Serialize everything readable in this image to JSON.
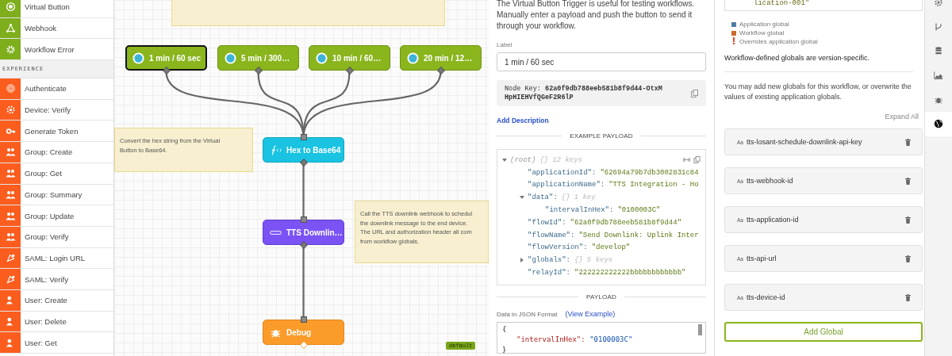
{
  "sidebar": {
    "items": [
      {
        "label": "Virtual Button",
        "kind": "trigger"
      },
      {
        "label": "Webhook",
        "kind": "trigger"
      },
      {
        "label": "Workflow Error",
        "kind": "trigger"
      },
      {
        "label": "EXPERIENCE",
        "kind": "header"
      },
      {
        "label": "Authenticate",
        "kind": "experience"
      },
      {
        "label": "Device: Verify",
        "kind": "experience"
      },
      {
        "label": "Generate Token",
        "kind": "experience"
      },
      {
        "label": "Group: Create",
        "kind": "experience"
      },
      {
        "label": "Group: Get",
        "kind": "experience"
      },
      {
        "label": "Group: Summary",
        "kind": "experience"
      },
      {
        "label": "Group: Update",
        "kind": "experience"
      },
      {
        "label": "Group: Verify",
        "kind": "experience"
      },
      {
        "label": "SAML: Login URL",
        "kind": "experience"
      },
      {
        "label": "SAML: Verify",
        "kind": "experience"
      },
      {
        "label": "User: Create",
        "kind": "experience"
      },
      {
        "label": "User: Delete",
        "kind": "experience"
      },
      {
        "label": "User: Get",
        "kind": "experience"
      }
    ]
  },
  "canvas": {
    "notes": [
      {
        "lines": [
          "Convert the hex string from the Virtual",
          "Button to Base64."
        ]
      },
      {
        "lines": [
          "Call the TTS downlink webhook to schedul",
          "the downlink message to the end device.",
          "The URL and authorization header all com",
          "from workflow globals."
        ]
      }
    ],
    "nodes": [
      {
        "label": "1 min / 60 sec",
        "kind": "trigger",
        "selected": true
      },
      {
        "label": "5 min / 300…",
        "kind": "trigger",
        "selected": false
      },
      {
        "label": "10 min / 60…",
        "kind": "trigger",
        "selected": false
      },
      {
        "label": "20 min / 12…",
        "kind": "trigger",
        "selected": false
      },
      {
        "label": "Hex to Base64",
        "kind": "function",
        "selected": false
      },
      {
        "label": "TTS Downlin…",
        "kind": "http",
        "selected": false
      },
      {
        "label": "Debug",
        "kind": "debug",
        "selected": false
      }
    ],
    "version_badge": "default"
  },
  "node_editor": {
    "description": "The Virtual Button Trigger is useful for testing workflows. Manually enter a payload and push the button to send it through your workflow.",
    "label_field": {
      "label": "Label",
      "value": "1 min / 60 sec"
    },
    "node_key": {
      "label": "Node Key:",
      "value": "62a0f9db788eeb581b8f9d44-OtxMHpHIEHVfQGeF2R6lP"
    },
    "add_description": "Add Description",
    "example_payload": {
      "title": "EXAMPLE PAYLOAD",
      "root": {
        "kind": "root",
        "key": "(root)",
        "braces": "{}",
        "summary": "12 keys",
        "expanded": true,
        "children": [
          {
            "key": "\"applicationId\":",
            "value": "\"62694a79b7db3002831c84"
          },
          {
            "key": "\"applicationName\":",
            "value": "\"TTS Integration - Ho"
          },
          {
            "key": "\"data\":",
            "braces": "{}",
            "summary": "1 key",
            "expanded": true,
            "children": [
              {
                "key": "\"intervalInHex\":",
                "value": "\"0100003C\""
              }
            ]
          },
          {
            "key": "\"flowId\":",
            "value": "\"62a0f9db788eeb581b8f9d44\""
          },
          {
            "key": "\"flowName\":",
            "value": "\"Send Downlink: Uplink Inter"
          },
          {
            "key": "\"flowVersion\":",
            "value": "\"develop\""
          },
          {
            "key": "\"globals\":",
            "braces": "{}",
            "summary": "5 keys",
            "expanded": false
          },
          {
            "key": "\"relayId\":",
            "value": "\"222222222222bbbbbbbbbbbb\""
          }
        ]
      }
    },
    "payload": {
      "title": "PAYLOAD",
      "field_label": "Data in JSON Format",
      "view_example": "(View Example)",
      "code_lines": [
        {
          "kind": "punct",
          "text": "{"
        },
        {
          "kind": "pair",
          "key": "\"intervalInHex\":",
          "value": "\"0100003C\""
        },
        {
          "kind": "punct",
          "text": "}"
        }
      ]
    }
  },
  "globals_panel": {
    "code_tail": "lication-001\"",
    "legend": [
      {
        "kind": "square",
        "label": "Application global",
        "color": "#4f7ca6"
      },
      {
        "kind": "square",
        "label": "Workflow global",
        "color": "#c8692b"
      },
      {
        "kind": "mark",
        "mark": "!",
        "label": "Overrides application global",
        "color": "#e8452c"
      }
    ],
    "version_note": "Workflow-defined globals are version-specific.",
    "intro": "You may add new globals for this workflow, or overwrite the values of existing application globals.",
    "expand_all": "Expand All",
    "globals": [
      {
        "type_badge": "Aa",
        "name": "tts-losant-schedule-downlink-api-key"
      },
      {
        "type_badge": "Aa",
        "name": "tts-webhook-id"
      },
      {
        "type_badge": "Aa",
        "name": "tts-application-id"
      },
      {
        "type_badge": "Aa",
        "name": "tts-api-url"
      },
      {
        "type_badge": "Aa",
        "name": "tts-device-id"
      }
    ],
    "add_button": "Add Global"
  },
  "tool_tabs": [
    {
      "selected": false
    },
    {
      "selected": false
    },
    {
      "selected": false
    },
    {
      "selected": false
    },
    {
      "selected": false
    },
    {
      "selected": true
    }
  ]
}
